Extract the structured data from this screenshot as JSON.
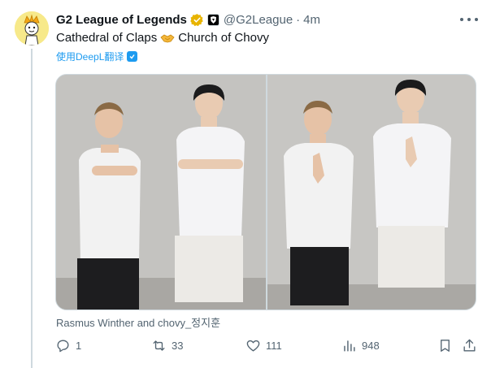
{
  "tweet": {
    "author": {
      "display_name": "G2 League of Legends",
      "handle": "@G2League",
      "avatar_icon": "avatar-cartoon-crown",
      "verified_badge": "gold-check-icon",
      "affiliate_badge": "g2-logo-icon"
    },
    "separator": "·",
    "time_ago": "4m",
    "text_before": "Cathedral of Claps",
    "text_emoji": "handshake-icon",
    "text_after": "Church of Chovy",
    "translate_label": "使用DeepL翻译",
    "media_caption": "Rasmus Winther and chovy_정지훈",
    "stats": {
      "replies": "1",
      "reposts": "33",
      "likes": "111",
      "views": "948"
    }
  },
  "colors": {
    "text_primary": "#0f1419",
    "text_secondary": "#536471",
    "link": "#1d9bf0",
    "verified_gold": "#e8b400",
    "border": "#cfd9de"
  }
}
